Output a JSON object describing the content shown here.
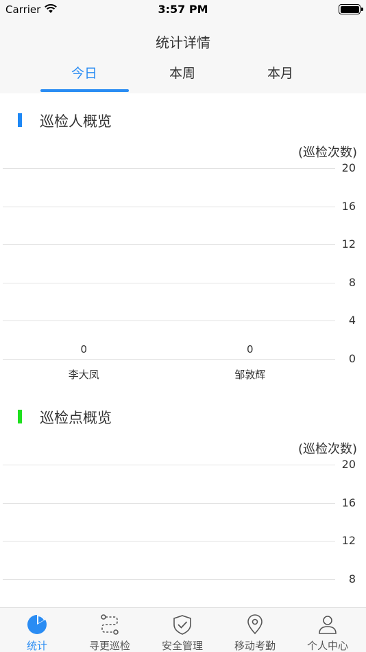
{
  "status": {
    "carrier": "Carrier",
    "time": "3:57 PM"
  },
  "header": {
    "title": "统计详情",
    "tabs": [
      {
        "label": "今日",
        "active": true
      },
      {
        "label": "本周",
        "active": false
      },
      {
        "label": "本月",
        "active": false
      }
    ]
  },
  "sections": [
    {
      "title": "巡检人概览",
      "accent": "#1e88f5"
    },
    {
      "title": "巡检点概览",
      "accent": "#1ee01e"
    }
  ],
  "chart_data": [
    {
      "type": "bar",
      "title": "巡检人概览",
      "ylabel": "(巡检次数)",
      "categories": [
        "李大凤",
        "邹敦辉"
      ],
      "values": [
        0,
        0
      ],
      "yticks": [
        "20",
        "16",
        "12",
        "8",
        "4",
        "0"
      ],
      "ylim": [
        0,
        20
      ],
      "grid": true
    },
    {
      "type": "bar",
      "title": "巡检点概览",
      "ylabel": "(巡检次数)",
      "categories": [],
      "values": [],
      "yticks": [
        "20",
        "16",
        "12",
        "8"
      ],
      "ylim": [
        0,
        20
      ],
      "grid": true
    }
  ],
  "tabbar": {
    "items": [
      {
        "label": "统计",
        "icon": "pie-chart-icon",
        "active": true
      },
      {
        "label": "寻更巡检",
        "icon": "route-icon",
        "active": false
      },
      {
        "label": "安全管理",
        "icon": "shield-check-icon",
        "active": false
      },
      {
        "label": "移动考勤",
        "icon": "location-pin-icon",
        "active": false
      },
      {
        "label": "个人中心",
        "icon": "person-icon",
        "active": false
      }
    ]
  },
  "colors": {
    "accent": "#2a8cf3",
    "header_bg": "#f7f7f7",
    "grid": "#e2e2e2"
  }
}
